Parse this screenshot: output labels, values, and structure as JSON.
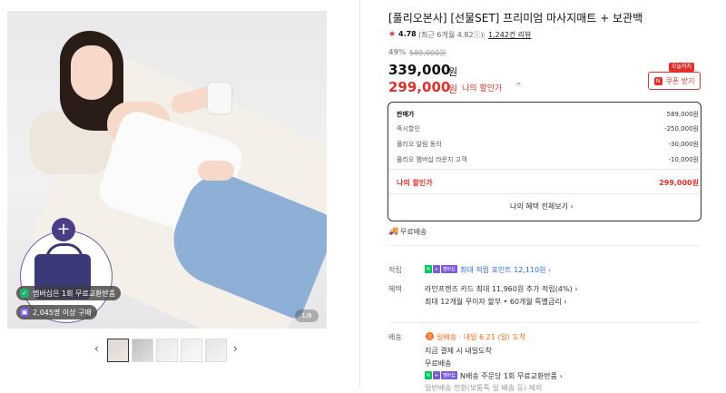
{
  "gallery": {
    "page_indicator": "1/8",
    "bag_promo": {
      "plus": "+",
      "pill_1": "멤버십은 1회 무료교환반품",
      "pill_2": "2,045명 이상 구매"
    },
    "thumbnails": 5,
    "prev_arrow": "‹",
    "next_arrow": "›"
  },
  "product": {
    "title": "[풀리오본사] [선물SET] 프리미엄 마사지매트 + 보관백",
    "rating_star": "★",
    "rating": "4.78",
    "recent_rating": "(최근 6개월 4.82ⓘ)",
    "review_count": "1,242건 리뷰",
    "discount_rate": "49%",
    "original_price": "589,000원",
    "price": "339,000",
    "price_unit": "원",
    "my_price": "299,000",
    "my_price_unit": "원",
    "my_price_label": "나의 할인가",
    "my_price_caret": "^",
    "today_tag": "오늘까지",
    "coupon_label": "쿠폰 받기",
    "coupon_icon": "N"
  },
  "price_breakdown": {
    "rows": [
      {
        "label": "판매가",
        "value": "589,000원"
      },
      {
        "label": "즉시할인",
        "value": "-250,000원"
      },
      {
        "label": "풀리오 알림 동의",
        "value": "-30,000원"
      },
      {
        "label": "풀리오 멤버십 라운지 고객",
        "value": "-10,000원"
      }
    ],
    "total_label": "나의 할인가",
    "total_value": "299,000원",
    "view_all": "나의 혜택 전체보기 ›"
  },
  "shipping_summary": {
    "icon": "🚚",
    "label": "무료배송"
  },
  "points": {
    "label": "적립",
    "badge_n": "N",
    "badge_plus": "+",
    "badge_member": "멤버십",
    "text": "최대 적립 포인트 12,110원 ›"
  },
  "benefits": {
    "label": "혜택",
    "line1": "라인프렌즈 카드 최대 11,960원 추가 적립(4%) ›",
    "line2": "최대 12개월 무이자 할부 • 60개월 특별금리 ›"
  },
  "delivery": {
    "label": "배송",
    "today_badge": "오",
    "today_text": "일배송 · 내일 6.21 (일) 도착",
    "line2": "지금 결제 시 내일도착",
    "line3": "무료배송",
    "member_text": "N배송 주문당 1회 무료교환반품 ›",
    "cut_text": "일반배송 전환(보통특 일 배송 등) 제외"
  },
  "colors": {
    "accent_red": "#e2302b",
    "link_blue": "#2d6be0",
    "orange": "#ff6a1a",
    "naver_green": "#03c75a",
    "member_purple": "#7b5cd6"
  }
}
